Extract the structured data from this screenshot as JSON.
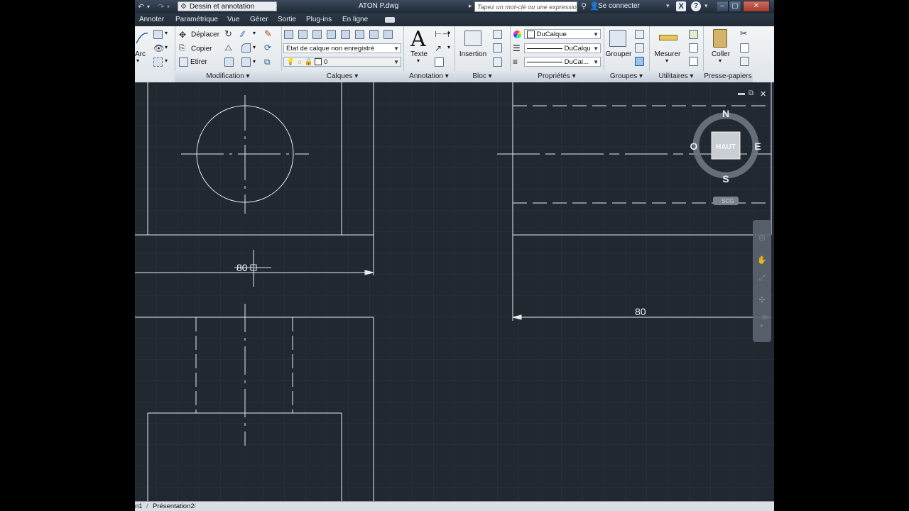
{
  "titlebar": {
    "workspace": "Dessin et annotation",
    "document_title": "ATON P.dwg",
    "search_placeholder": "Tapez un mot-clé ou une expression",
    "signin": "Se connecter"
  },
  "menu": [
    "Annoter",
    "Paramétrique",
    "Vue",
    "Gérer",
    "Sortie",
    "Plug-ins",
    "En ligne"
  ],
  "ribbon": {
    "draw_partial": {
      "arc_label": "Arc"
    },
    "modification": {
      "title": "Modification",
      "move": "Déplacer",
      "copy": "Copier",
      "stretch": "Etirer"
    },
    "layers": {
      "title": "Calques",
      "state": "Etat de calque non enregistré",
      "current_layer": "0"
    },
    "annotation": {
      "title": "Annotation",
      "text": "Texte"
    },
    "block": {
      "title": "Bloc",
      "insert": "Insertion"
    },
    "properties": {
      "title": "Propriétés",
      "color": "DuCalque",
      "linetype": "DuCalqu",
      "lineweight": "DuCal..."
    },
    "groups": {
      "title": "Groupes",
      "group": "Grouper"
    },
    "utilities": {
      "title": "Utilitaires",
      "measure": "Mesurer"
    },
    "clipboard": {
      "title": "Presse-papiers",
      "paste": "Coller"
    }
  },
  "drawing": {
    "dim_left": "80",
    "dim_right": "80"
  },
  "viewcube": {
    "north": "N",
    "south": "S",
    "east": "E",
    "west": "O",
    "face": "HAUT",
    "ucs": "SCG"
  },
  "tabs": [
    "n1",
    "Présentation2"
  ]
}
